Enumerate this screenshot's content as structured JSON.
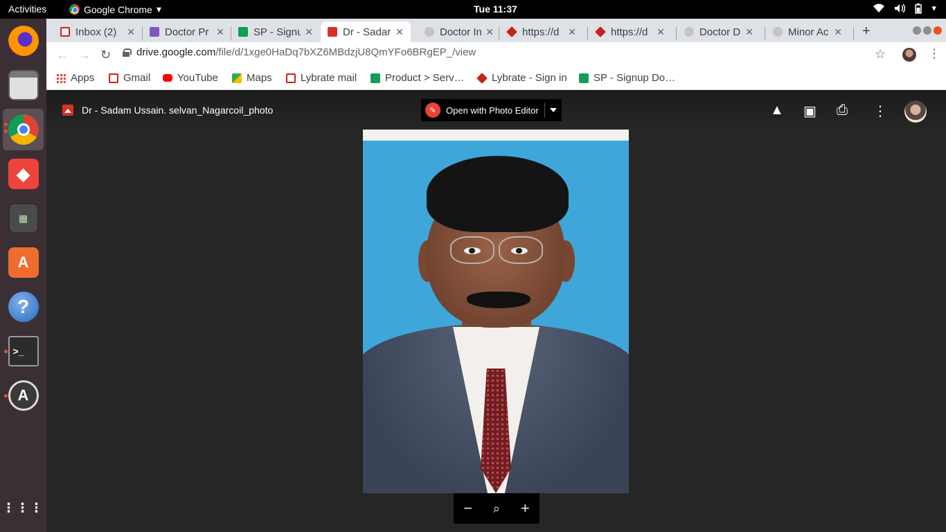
{
  "topbar": {
    "activities": "Activities",
    "app_name": "Google Chrome",
    "clock": "Tue 11:37"
  },
  "dock": {
    "items": [
      "firefox-icon",
      "files-icon",
      "chrome-icon",
      "anydesk-icon",
      "calculator-icon",
      "software-center-icon",
      "help-icon",
      "terminal-icon",
      "software-updater-icon",
      "app-grid-icon"
    ]
  },
  "tabs": [
    {
      "title": "Inbox (2)",
      "icon_color": "#c5221f"
    },
    {
      "title": "Doctor Pr",
      "icon_color": "#7e57c2"
    },
    {
      "title": "SP - Signu",
      "icon_color": "#0f9d58"
    },
    {
      "title": "Dr - Sadar",
      "icon_color": "#d93025",
      "active": true
    },
    {
      "title": "Doctor In",
      "icon_color": "#c4c4c4"
    },
    {
      "title": "https://d",
      "icon_color": "#c5221f"
    },
    {
      "title": "https://d",
      "icon_color": "#c5221f"
    },
    {
      "title": "Doctor D",
      "icon_color": "#c4c4c4"
    },
    {
      "title": "Minor Ac",
      "icon_color": "#c4c4c4"
    }
  ],
  "address_bar": {
    "host": "drive.google.com",
    "path": "/file/d/1xge0HaDq7bXZ6MBdzjU8QmYFo6BRgEP_/view"
  },
  "bookmarks": [
    {
      "label": "Apps",
      "icon_color": "#4285f4"
    },
    {
      "label": "Gmail",
      "icon_color": "#c5221f"
    },
    {
      "label": "YouTube",
      "icon_color": "#ff0000"
    },
    {
      "label": "Maps",
      "icon_color": "#34a853"
    },
    {
      "label": "Lybrate mail",
      "icon_color": "#c5221f"
    },
    {
      "label": "Product > Serv…",
      "icon_color": "#0f9d58"
    },
    {
      "label": "Lybrate - Sign in",
      "icon_color": "#c5221f"
    },
    {
      "label": "SP - Signup Do…",
      "icon_color": "#0f9d58"
    }
  ],
  "viewer": {
    "file_name": "Dr - Sadam Ussain. selvan_Nagarcoil_photo",
    "open_with_label": "Open with Photo Editor",
    "header_icons": [
      "add-to-drive-icon",
      "add-comment-icon",
      "print-icon",
      "more-options-icon"
    ],
    "zoom_controls": [
      "zoom-out-icon",
      "zoom-reset-icon",
      "zoom-in-icon"
    ]
  },
  "colors": {
    "viewer_bg": "#262626",
    "dock_bg": "#3b2f36",
    "tabstrip_bg": "#dee1e6",
    "accent": "#e95420"
  }
}
